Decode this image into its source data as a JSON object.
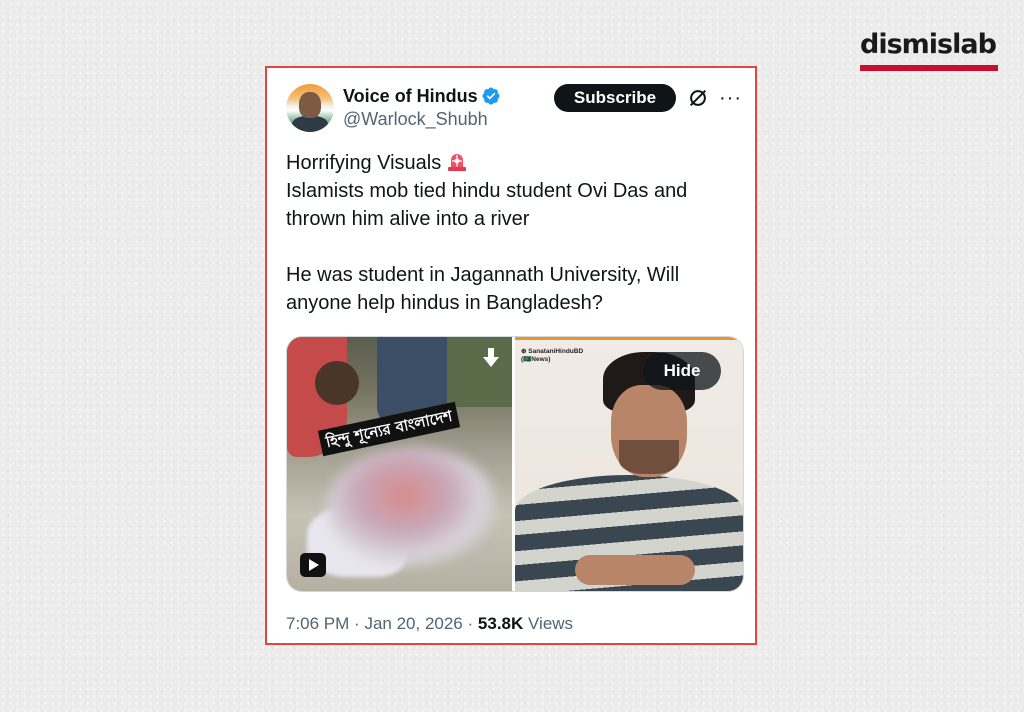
{
  "brand": {
    "name": "dismislab",
    "accent_color": "#c8102e"
  },
  "tweet": {
    "author": {
      "display_name": "Voice of Hindus",
      "handle": "@Warlock_Shubh",
      "verified": true
    },
    "actions": {
      "subscribe_label": "Subscribe",
      "grok_icon": "grok-icon",
      "more_icon": "more-icon",
      "more_label": "···"
    },
    "body": {
      "line1": "Horrifying Visuals",
      "emoji": "siren-emoji",
      "line2": "Islamists mob tied hindu student Ovi Das and thrown him alive into a river",
      "line3": "He was student in Jagannath University, Will anyone help hindus in Bangladesh?"
    },
    "media": {
      "left_overlay_text": "হিন্দু শূন্যের বাংলাদেশ",
      "right_watermark_line1": "⊕ SanataniHinduBD",
      "right_watermark_line2": "(🇧🇩News)",
      "hide_label": "Hide"
    },
    "meta": {
      "time": "7:06 PM",
      "separator": "·",
      "date": "Jan 20, 2026",
      "views_count": "53.8K",
      "views_label": "Views"
    }
  }
}
